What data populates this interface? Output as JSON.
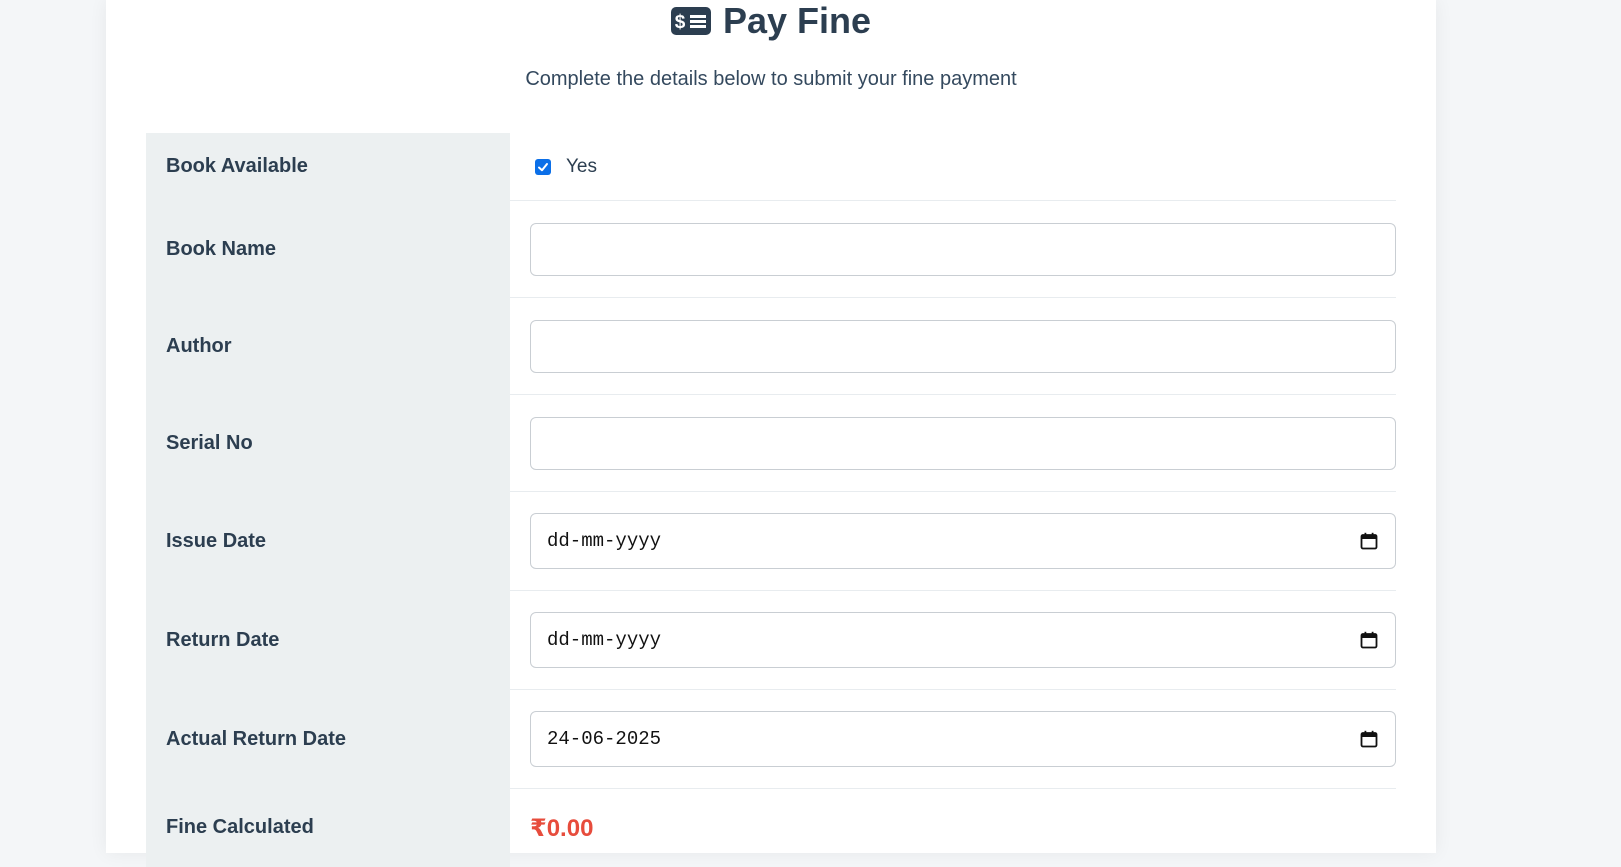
{
  "header": {
    "title": "Pay Fine",
    "title_icon": "money-bill-icon",
    "subtitle": "Complete the details below to submit your fine payment"
  },
  "form": {
    "book_available": {
      "label": "Book Available",
      "checked": true,
      "option_label": "Yes"
    },
    "book_name": {
      "label": "Book Name",
      "value": ""
    },
    "author": {
      "label": "Author",
      "value": ""
    },
    "serial_no": {
      "label": "Serial No",
      "value": ""
    },
    "issue_date": {
      "label": "Issue Date",
      "value": "dd-mm-yyyy"
    },
    "return_date": {
      "label": "Return Date",
      "value": "dd-mm-yyyy"
    },
    "actual_return_date": {
      "label": "Actual Return Date",
      "value": "24-06-2025"
    },
    "fine_calculated": {
      "label": "Fine Calculated",
      "value": "₹0.00"
    }
  },
  "colors": {
    "accent_checkbox": "#0b6fe8",
    "fine_text": "#e74c3c",
    "label_bg": "#ecf0f1",
    "heading_text": "#2c3e50"
  }
}
